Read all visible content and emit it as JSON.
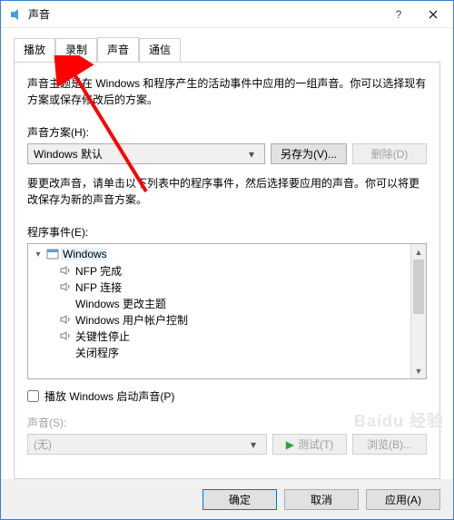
{
  "title": "声音",
  "tabs": [
    "播放",
    "录制",
    "声音",
    "通信"
  ],
  "active_tab_index": 2,
  "panel": {
    "intro": "声音主题是在 Windows 和程序产生的活动事件中应用的一组声音。你可以选择现有方案或保存修改后的方案。",
    "scheme_label": "声音方案(H):",
    "scheme_value": "Windows 默认",
    "save_as": "另存为(V)...",
    "delete": "删除(D)",
    "events_desc": "要更改声音，请单击以下列表中的程序事件，然后选择要应用的声音。你可以将更改保存为新的声音方案。",
    "events_label": "程序事件(E):",
    "tree": {
      "root": "Windows",
      "items": [
        {
          "icon": true,
          "label": "NFP 完成"
        },
        {
          "icon": true,
          "label": "NFP 连接"
        },
        {
          "icon": false,
          "label": "Windows 更改主题"
        },
        {
          "icon": true,
          "label": "Windows 用户帐户控制"
        },
        {
          "icon": true,
          "label": "关键性停止"
        },
        {
          "icon": false,
          "label": "关闭程序"
        }
      ]
    },
    "play_startup": "播放 Windows 启动声音(P)",
    "sound_label": "声音(S):",
    "sound_value": "(无)",
    "test": "测试(T)",
    "browse": "浏览(B)..."
  },
  "footer": {
    "ok": "确定",
    "cancel": "取消",
    "apply": "应用(A)"
  },
  "annotation": {
    "color": "#ff0000"
  },
  "watermark": "Baidu 经验"
}
